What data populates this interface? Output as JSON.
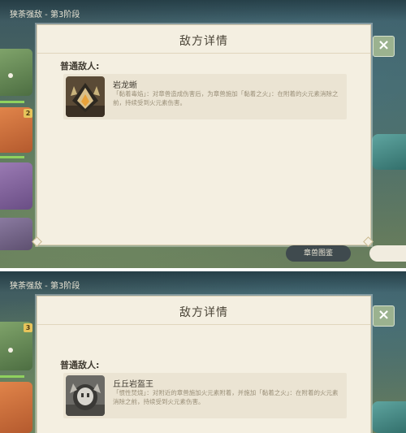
{
  "screens": [
    {
      "stage_title": "狭荼强敌 - 第3阶段",
      "dialog_title": "敌方详情",
      "section_label": "普通敌人:",
      "enemy": {
        "name": "岩龙蜥",
        "description": "「黏着毒焰」：对章兽造成伤害后，为章兽施加「黏着之火」：在附着的火元素消除之前，持续受到火元素伤害。"
      },
      "close_icon": "×",
      "thumb_badge": "2",
      "bottom_button_label": "章兽图鉴"
    },
    {
      "stage_title": "狭荼强敌 - 第3阶段",
      "dialog_title": "敌方详情",
      "section_label": "普通敌人:",
      "enemy": {
        "name": "丘丘岩盔王",
        "description": "「惯性焚烧」：对附近的章兽施加火元素附着，并施加「黏着之火」：在附着的火元素消除之前，持续受到火元素伤害。"
      },
      "close_icon": "×",
      "thumb_badge": "3"
    }
  ],
  "colors": {
    "panel_bg": "#f4efe1",
    "card_bg": "#ebe4d3",
    "title_text": "#4b4538",
    "desc_text": "#9a8f78",
    "badge": "#e7c45b",
    "close_bg": "#9bb28f"
  }
}
